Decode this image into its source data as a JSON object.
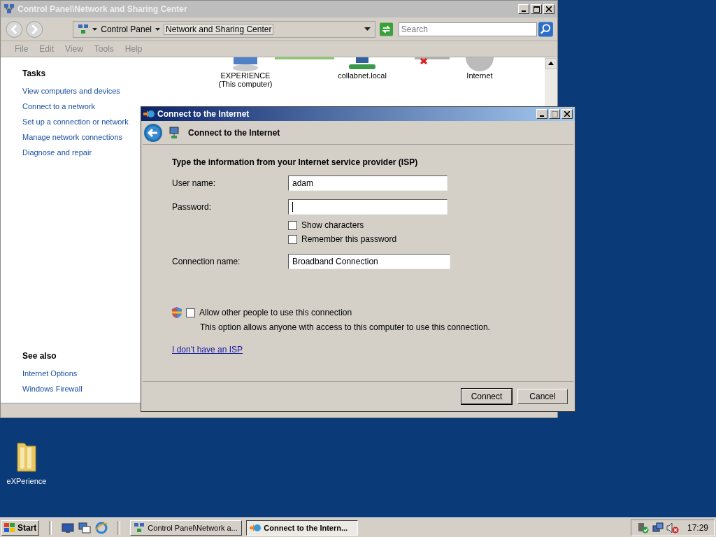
{
  "explorer": {
    "title": "Control Panel\\Network and Sharing Center",
    "breadcrumb": [
      "Control Panel",
      "Network and Sharing Center"
    ],
    "search": {
      "placeholder": "Search"
    },
    "menu": [
      "File",
      "Edit",
      "View",
      "Tools",
      "Help"
    ],
    "network_map": [
      {
        "label": "EXPERIENCE",
        "sublabel": "(This computer)"
      },
      {
        "label": "collabnet.local"
      },
      {
        "label": "Internet"
      }
    ],
    "tasks": {
      "title": "Tasks",
      "items": [
        "View computers and devices",
        "Connect to a network",
        "Set up a connection or network",
        "Manage network connections",
        "Diagnose and repair"
      ]
    },
    "see_also": {
      "title": "See also",
      "items": [
        "Internet Options",
        "Windows Firewall"
      ]
    }
  },
  "dialog": {
    "title": "Connect to the Internet",
    "heading": "Connect to the Internet",
    "instruction": "Type the information from your Internet service provider (ISP)",
    "fields": [
      {
        "label": "User name:",
        "value": "adam",
        "focused": false
      },
      {
        "label": "Password:",
        "focused": true
      }
    ],
    "checkboxes": [
      {
        "label": "Show characters",
        "checked": false
      },
      {
        "label": "Remember this password",
        "checked": false
      }
    ],
    "connection_name": {
      "label": "Connection name:",
      "value": "Broadband Connection"
    },
    "allow": {
      "label": "Allow other people to use this connection",
      "description": "This option allows anyone with access to this computer to use this connection.",
      "checked": false
    },
    "link": "I don't have an ISP",
    "buttons": [
      {
        "label": "Connect",
        "default": true
      },
      {
        "label": "Cancel",
        "default": false
      }
    ]
  },
  "desktop_icons": [
    {
      "label": "eXPerience"
    }
  ],
  "taskbar": {
    "start": "Start",
    "tasks": [
      {
        "label": "Control Panel\\Network a...",
        "selected": false
      },
      {
        "label": "Connect to the Intern...",
        "selected": true
      }
    ],
    "clock": "17:29"
  }
}
